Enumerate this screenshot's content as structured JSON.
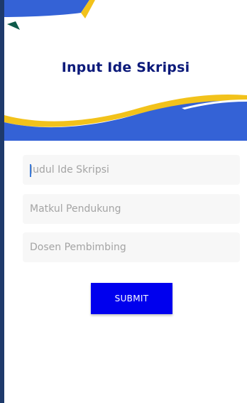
{
  "header": {
    "title": "Input Ide Skripsi"
  },
  "form": {
    "fields": [
      {
        "placeholder": "Judul Ide Skripsi",
        "value": ""
      },
      {
        "placeholder": "Matkul Pendukung",
        "value": ""
      },
      {
        "placeholder": "Dosen Pembimbing",
        "value": ""
      }
    ],
    "submit_label": "SUBMIT"
  },
  "colors": {
    "title": "#0c1a7a",
    "accent_blue": "#3462d6",
    "wave_yellow": "#f2c21b",
    "button": "#0000ee",
    "border": "#1e3a6b"
  }
}
